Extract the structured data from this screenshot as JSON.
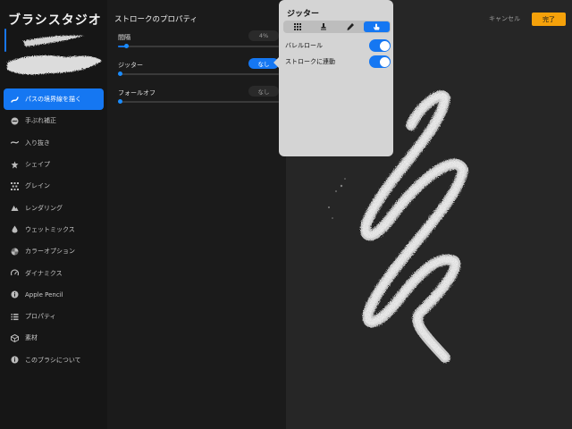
{
  "app": {
    "title": "ブラシスタジオ"
  },
  "sidebar": {
    "items": [
      {
        "label": "パスの境界線を描く",
        "icon": "stroke-path-icon",
        "active": true
      },
      {
        "label": "手ぶれ補正",
        "icon": "stabilization-icon",
        "active": false
      },
      {
        "label": "入り抜き",
        "icon": "taper-icon",
        "active": false
      },
      {
        "label": "シェイプ",
        "icon": "shape-icon",
        "active": false
      },
      {
        "label": "グレイン",
        "icon": "grain-icon",
        "active": false
      },
      {
        "label": "レンダリング",
        "icon": "rendering-icon",
        "active": false
      },
      {
        "label": "ウェットミックス",
        "icon": "wet-mix-icon",
        "active": false
      },
      {
        "label": "カラーオプション",
        "icon": "color-options-icon",
        "active": false
      },
      {
        "label": "ダイナミクス",
        "icon": "dynamics-icon",
        "active": false
      },
      {
        "label": "Apple Pencil",
        "icon": "apple-pencil-icon",
        "active": false
      },
      {
        "label": "プロパティ",
        "icon": "properties-icon",
        "active": false
      },
      {
        "label": "素材",
        "icon": "materials-icon",
        "active": false
      },
      {
        "label": "このブラシについて",
        "icon": "about-icon",
        "active": false
      }
    ]
  },
  "properties": {
    "title": "ストロークのプロパティ",
    "items": [
      {
        "label": "間隔",
        "value": "4%",
        "fraction": 0.05,
        "active": false
      },
      {
        "label": "ジッター",
        "value": "なし",
        "fraction": 0.0,
        "active": true
      },
      {
        "label": "フォールオフ",
        "value": "なし",
        "fraction": 0.0,
        "active": false
      }
    ]
  },
  "header": {
    "cancel_label": "キャンセル",
    "done_label": "完了"
  },
  "popover": {
    "title": "ジッター",
    "segments": [
      "grid-icon",
      "stamp-icon",
      "pencil-icon",
      "finger-icon"
    ],
    "active_segment": 3,
    "toggles": [
      {
        "label": "バレルロール",
        "on": true
      },
      {
        "label": "ストロークに連動",
        "on": true
      }
    ]
  },
  "colors": {
    "accent": "#1577f2",
    "done": "#f5a10a"
  }
}
